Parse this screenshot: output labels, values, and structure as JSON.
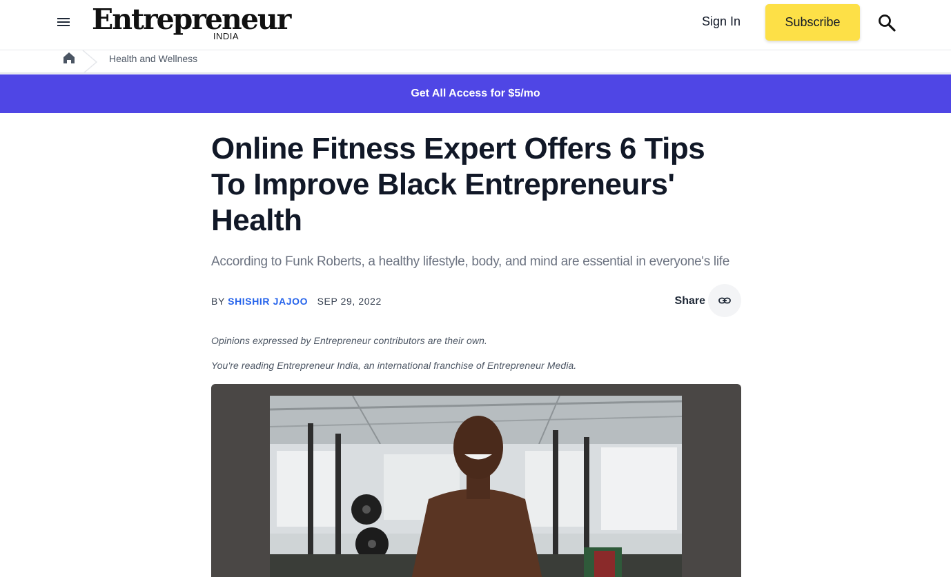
{
  "header": {
    "logo_text": "Entrepreneur",
    "logo_edition": "INDIA",
    "signin_label": "Sign In",
    "subscribe_label": "Subscribe"
  },
  "breadcrumb": {
    "items": [
      "Health and Wellness"
    ]
  },
  "promo": {
    "label": "Get All Access for $5/mo"
  },
  "article": {
    "headline": "Online Fitness Expert Offers 6 Tips To Improve Black Entrepreneurs' Health",
    "dek": "According to Funk Roberts, a healthy lifestyle, body, and mind are essential in everyone's life",
    "byline_prefix": "BY",
    "author": "SHISHIR JAJOO",
    "date": "SEP 29, 2022",
    "share_label": "Share",
    "disclaimer_1": "Opinions expressed by Entrepreneur contributors are their own.",
    "disclaimer_2": "You're reading Entrepreneur India, an international franchise of Entrepreneur Media."
  },
  "colors": {
    "accent_yellow": "#fde047",
    "promo_purple": "#4f46e5",
    "author_blue": "#2563eb"
  },
  "icons": {
    "menu": "hamburger-menu-icon",
    "search": "search-icon",
    "home": "home-icon",
    "share": "link-icon"
  }
}
